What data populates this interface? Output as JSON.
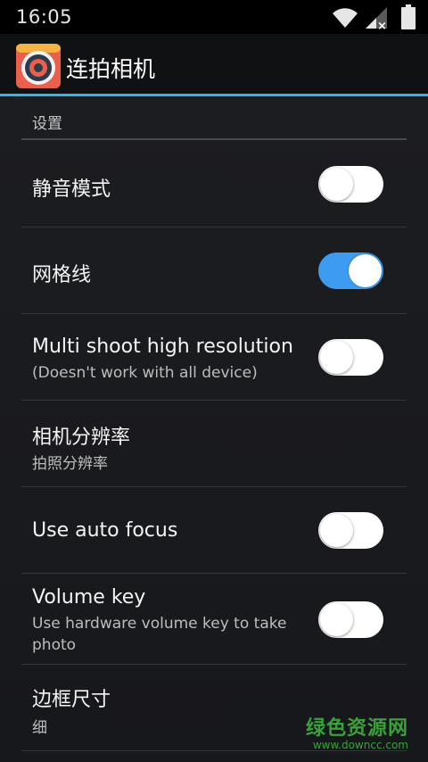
{
  "status_bar": {
    "time": "16:05",
    "icons": [
      "wifi-icon",
      "signal-icon",
      "battery-icon"
    ]
  },
  "action_bar": {
    "title": "连拍相机",
    "accent_color": "#33b5e5",
    "app_icon": "camera-lens-icon"
  },
  "settings": {
    "section_header": "设置",
    "items": [
      {
        "title": "静音模式",
        "summary": "",
        "toggle": false
      },
      {
        "title": "网格线",
        "summary": "",
        "toggle": true
      },
      {
        "title": "Multi shoot high resolution",
        "summary": "(Doesn't work with all device)",
        "toggle": false
      },
      {
        "title": "相机分辨率",
        "summary": "拍照分辨率"
      },
      {
        "title": "Use auto focus",
        "summary": "",
        "toggle": false
      },
      {
        "title": "Volume key",
        "summary_line1": "Use hardware volume key to take",
        "summary_line2": "photo",
        "toggle": false
      },
      {
        "title": "边框尺寸",
        "summary": "细"
      }
    ]
  },
  "watermark": {
    "text": "绿色资源网",
    "url": "www.downcc.com"
  },
  "colors": {
    "switch_on": "#3d9cf0",
    "switch_off": "#ffffff"
  }
}
